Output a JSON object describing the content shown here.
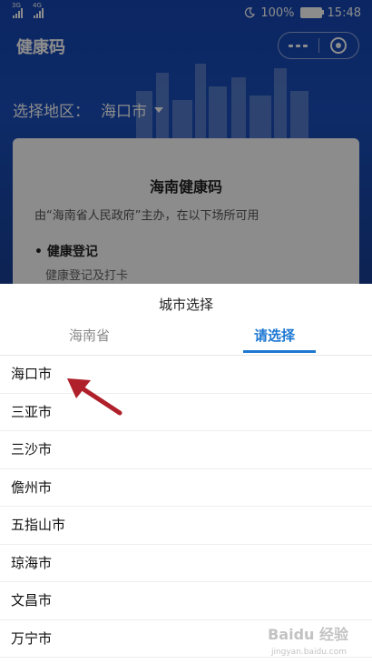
{
  "status_bar": {
    "net1": "3G",
    "net2": "4G",
    "battery": "100%",
    "time": "15:48"
  },
  "app": {
    "title": "健康码",
    "region_label": "选择地区：",
    "region_value": "海口市",
    "card": {
      "title": "海南健康码",
      "description": "由“海南省人民政府”主办，在以下场所可用",
      "item_title": "健康登记",
      "item_sub": "健康登记及打卡"
    }
  },
  "picker": {
    "title": "城市选择",
    "tabs": [
      "海南省",
      "请选择"
    ],
    "active_tab_index": 1,
    "cities": [
      "海口市",
      "三亚市",
      "三沙市",
      "儋州市",
      "五指山市",
      "琼海市",
      "文昌市",
      "万宁市"
    ]
  },
  "watermark": {
    "text": "Baidu 经验",
    "sub": "jingyan.baidu.com"
  },
  "colors": {
    "header_blue": "#1546b3",
    "accent_blue": "#1e78d2",
    "annotation_red": "#b0202a"
  }
}
